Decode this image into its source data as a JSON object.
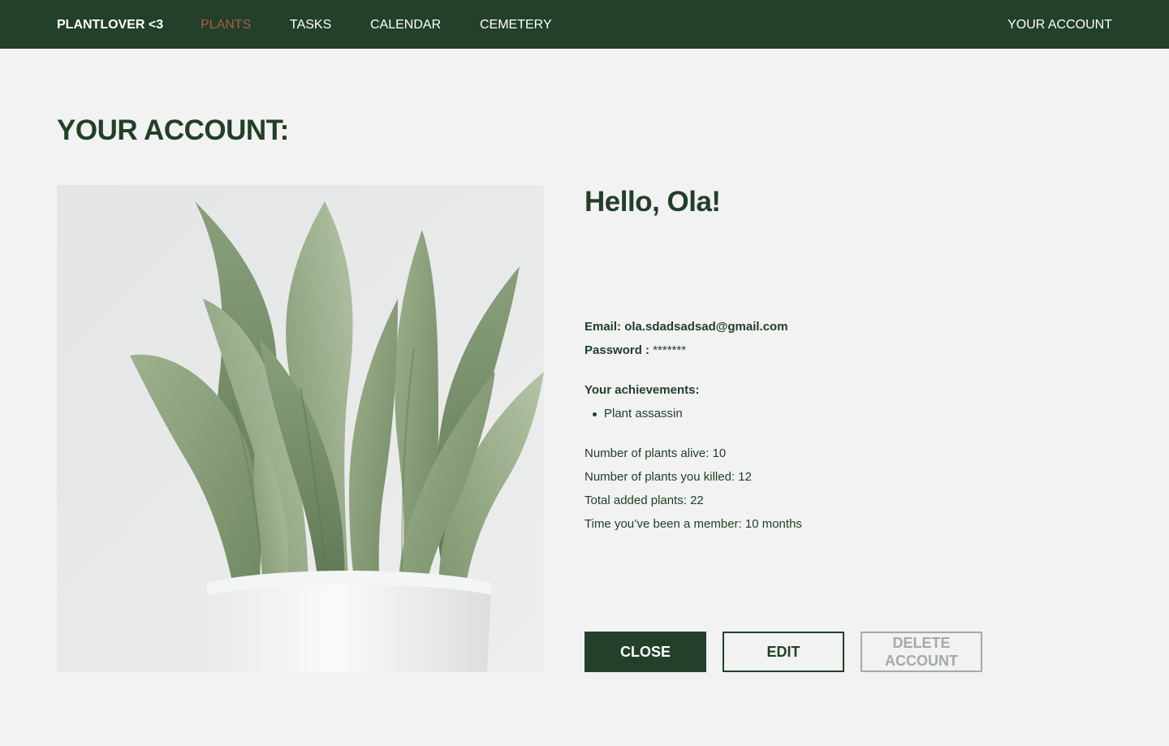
{
  "nav": {
    "brand": "PLANTLOVER <3",
    "items": [
      {
        "label": "PLANTS",
        "active": true
      },
      {
        "label": "TASKS"
      },
      {
        "label": "CALENDAR"
      },
      {
        "label": "CEMETERY"
      }
    ],
    "account": "YOUR ACCOUNT"
  },
  "page": {
    "title": "YOUR ACCOUNT:"
  },
  "profile": {
    "greeting": "Hello, Ola!",
    "email_label": "Email:",
    "email_value": "ola.sdadsadsad@gmail.com",
    "password_label": "Password :",
    "password_value": "*******",
    "achievements_title": "Your achievements:",
    "achievements": [
      "Plant assassin"
    ],
    "stats": [
      "Number of plants alive: 10",
      "Number of plants you killed: 12",
      "Total added plants: 22",
      "Time you’ve been a member: 10 months"
    ]
  },
  "actions": {
    "close": "CLOSE",
    "edit": "EDIT",
    "delete": "DELETE ACCOUNT"
  },
  "colors": {
    "nav_bg": "#22402a",
    "accent_active": "#b45846",
    "text_dark": "#223f28",
    "page_bg": "#f2f2f2",
    "disabled": "#a4aba5"
  },
  "image": {
    "subject": "potted snake plant in white pot"
  }
}
